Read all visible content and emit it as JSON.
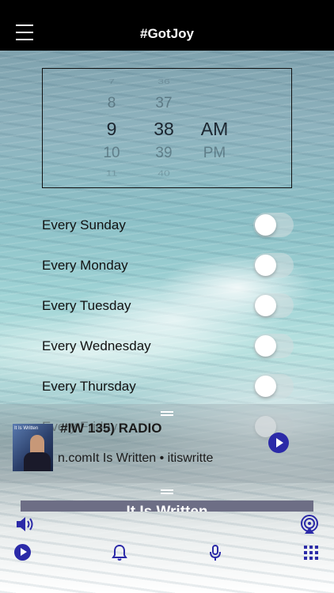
{
  "header": {
    "title": "#GotJoy"
  },
  "picker": {
    "hours": [
      "7",
      "8",
      "9",
      "10",
      "11"
    ],
    "minutes": [
      "36",
      "37",
      "38",
      "39",
      "40"
    ],
    "periods": [
      "AM",
      "PM"
    ]
  },
  "schedule": {
    "days": [
      {
        "label": "Every Sunday",
        "enabled": false
      },
      {
        "label": "Every Monday",
        "enabled": false
      },
      {
        "label": "Every Tuesday",
        "enabled": false
      },
      {
        "label": "Every Wednesday",
        "enabled": false
      },
      {
        "label": "Every Thursday",
        "enabled": false
      },
      {
        "label": "Every Friday",
        "enabled": false
      }
    ]
  },
  "mini_player": {
    "station": "#IW 135) RADIO",
    "subtitle": "n.comIt Is Written • itiswritte",
    "artwork_text": "It Is Written"
  },
  "now_playing": {
    "title": "It Is Written"
  },
  "colors": {
    "accent": "#2b2aa8",
    "header": "#000000"
  },
  "icons": {
    "menu": "menu-icon",
    "volume": "speaker-icon",
    "airplay": "airplay-icon",
    "play": "play-icon",
    "alarm": "bell-icon",
    "mic": "microphone-icon",
    "grid": "grid-icon"
  }
}
